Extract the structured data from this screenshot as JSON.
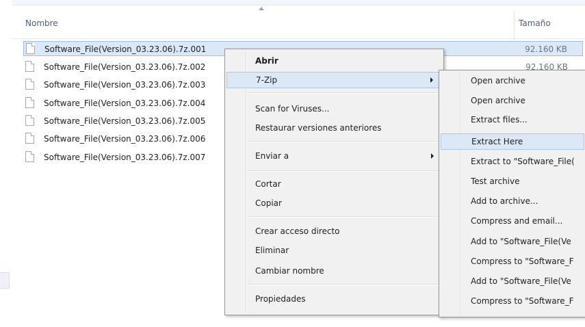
{
  "header": {
    "name_label": "Nombre",
    "size_label": "Tamaño"
  },
  "files": [
    {
      "name": "Software_File(Version_03.23.06).7z.001",
      "size": "92.160 KB",
      "selected": true
    },
    {
      "name": "Software_File(Version_03.23.06).7z.002",
      "size": "92.160 KB",
      "selected": false
    },
    {
      "name": "Software_File(Version_03.23.06).7z.003",
      "size": "",
      "selected": false
    },
    {
      "name": "Software_File(Version_03.23.06).7z.004",
      "size": "",
      "selected": false
    },
    {
      "name": "Software_File(Version_03.23.06).7z.005",
      "size": "",
      "selected": false
    },
    {
      "name": "Software_File(Version_03.23.06).7z.006",
      "size": "",
      "selected": false
    },
    {
      "name": "Software_File(Version_03.23.06).7z.007",
      "size": "",
      "selected": false
    }
  ],
  "context_menu": {
    "items": [
      {
        "label": "Abrir"
      },
      {
        "label": "7-Zip"
      },
      {
        "label": "Scan for Viruses..."
      },
      {
        "label": "Restaurar versiones anteriores"
      },
      {
        "label": "Enviar a"
      },
      {
        "label": "Cortar"
      },
      {
        "label": "Copiar"
      },
      {
        "label": "Crear acceso directo"
      },
      {
        "label": "Eliminar"
      },
      {
        "label": "Cambiar nombre"
      },
      {
        "label": "Propiedades"
      }
    ]
  },
  "submenu_7zip": {
    "items": [
      {
        "label": "Open archive"
      },
      {
        "label": "Open archive"
      },
      {
        "label": "Extract files..."
      },
      {
        "label": "Extract Here"
      },
      {
        "label": "Extract to \"Software_File("
      },
      {
        "label": "Test archive"
      },
      {
        "label": "Add to archive..."
      },
      {
        "label": "Compress and email..."
      },
      {
        "label": "Add to \"Software_File(Ve"
      },
      {
        "label": "Compress to \"Software_F"
      },
      {
        "label": "Add to \"Software_File(Ve"
      },
      {
        "label": "Compress to \"Software_F"
      }
    ]
  },
  "colors": {
    "selection_bg": "#dbe8f7",
    "selection_border": "#9ec0e6",
    "menu_bg": "#f1f1f1",
    "menu_highlight": "#dce8f6"
  }
}
